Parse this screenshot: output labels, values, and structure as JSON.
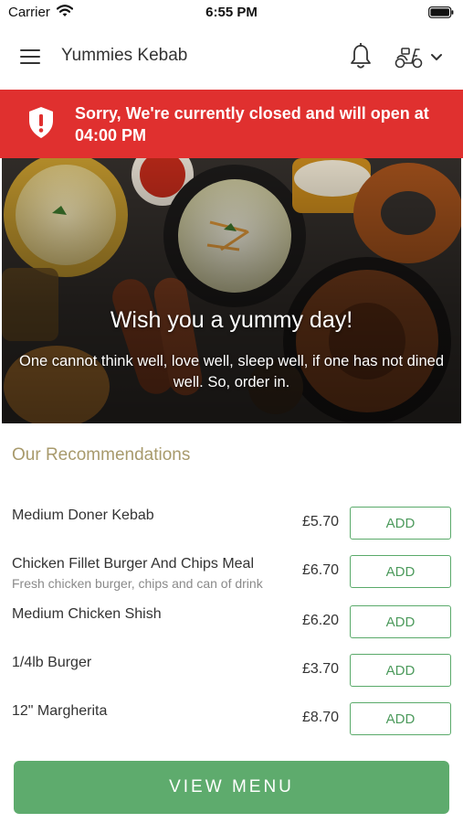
{
  "status_bar": {
    "carrier": "Carrier",
    "time": "6:55 PM"
  },
  "header": {
    "title": "Yummies Kebab",
    "icons": [
      "menu-icon",
      "bell-icon",
      "scooter-icon",
      "chevron-down-icon"
    ]
  },
  "banner": {
    "message": "Sorry, We're currently closed and will open at 04:00 PM",
    "background_color": "#e0302f"
  },
  "hero": {
    "heading": "Wish you a yummy day!",
    "subtext": "One cannot think well, love well, sleep well, if one has not dined well. So, order in."
  },
  "recommendations": {
    "title": "Our Recommendations",
    "items": [
      {
        "name": "Medium Doner Kebab",
        "description": "",
        "price": "£5.70",
        "action": "ADD"
      },
      {
        "name": "Chicken Fillet Burger And Chips Meal",
        "description": "Fresh chicken burger, chips and can of drink",
        "price": "£6.70",
        "action": "ADD"
      },
      {
        "name": "Medium Chicken Shish",
        "description": "",
        "price": "£6.20",
        "action": "ADD"
      },
      {
        "name": "1/4lb Burger",
        "description": "",
        "price": "£3.70",
        "action": "ADD"
      },
      {
        "name": "12\" Margherita",
        "description": "",
        "price": "£8.70",
        "action": "ADD"
      }
    ]
  },
  "footer": {
    "view_menu_label": "VIEW MENU",
    "accent_color": "#5eab6d"
  }
}
